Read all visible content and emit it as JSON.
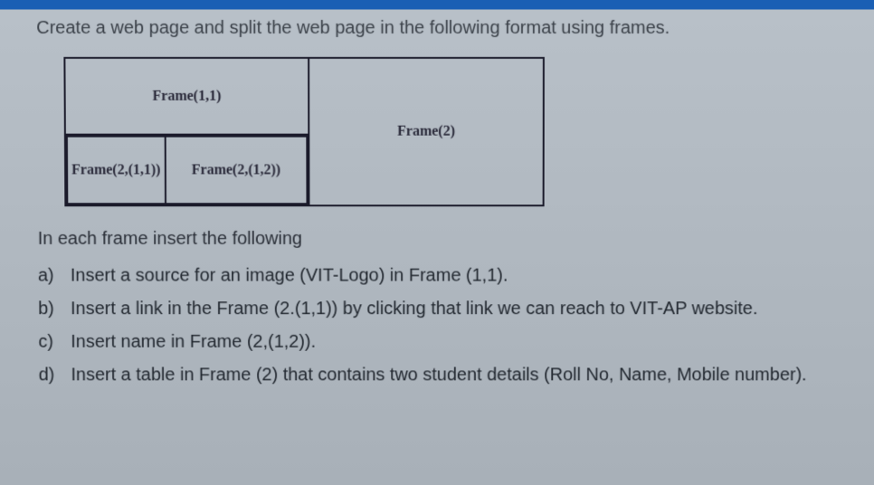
{
  "title": "Create a web page and split the web page in the following format using frames.",
  "frames": {
    "f11": "Frame(1,1)",
    "f211": "Frame(2,(1,1))",
    "f212": "Frame(2,(1,2))",
    "f2": "Frame(2)"
  },
  "subtitle": "In each frame insert the following",
  "items": [
    {
      "label": "a)",
      "text": "Insert a source for an image (VIT-Logo) in Frame (1,1)."
    },
    {
      "label": "b)",
      "text": "Insert a link in the Frame (2.(1,1)) by clicking that link we can reach to VIT-AP website."
    },
    {
      "label": "c)",
      "text": "Insert name in Frame (2,(1,2))."
    },
    {
      "label": "d)",
      "text": "Insert a table in Frame (2) that contains two student details (Roll No, Name, Mobile number)."
    }
  ]
}
